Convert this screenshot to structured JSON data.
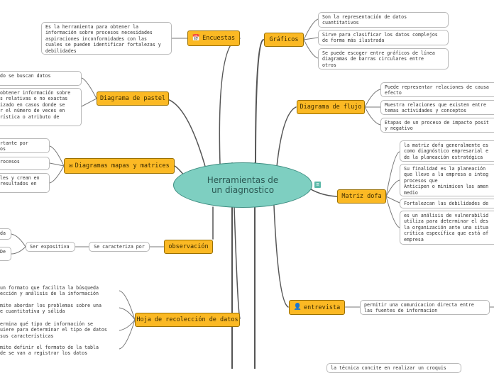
{
  "center": {
    "label": "Herramientas de\nun diagnostico"
  },
  "topics": {
    "graficos": "Gráficos",
    "encuestas": "Encuestas",
    "diagrama_pastel": "Diagrama de pastel",
    "diagrama_flujo": "Diagrama de flujo",
    "diagramas_mapas": "Diagramas mapas y matrices",
    "matriz_dofa": "Matriz dofa",
    "observacion": "observación",
    "se_caracteriza": "Se caracteriza por",
    "ser_expositiva": "Ser expositiva",
    "entrevista": "entrevista",
    "hoja_recoleccion": "Hoja de recolección de datos"
  },
  "notes": {
    "encuestas_1": "Es la herramienta para obtener la\ninformación sobre procesos necesidades\naspiraciones inconformidades con las\ncuales se pueden identificar fortalezas y\ndebilidades",
    "graficos_1": "Son la representación de datos\ncuantitativos",
    "graficos_2": "Sirve para clasificar los datos complejos\nde forma más ilustrada",
    "graficos_3": "Se puede escoger entre gráficos de línea\ndiagramas de barras circulares entre\notros",
    "pastel_1": "do se buscan datos",
    "pastel_2": "obtener información sobre\ns relativas o no exactas\nizado en casos donde se\nr el número de veces en\nrística o atributo de",
    "mapas_1": "rtante por\nos",
    "mapas_2": "rocesos",
    "mapas_3": "les y crean en\n resultados en",
    "flujo_1": "Puede representar relaciones de causa\nefecto",
    "flujo_2": "Muestra relaciones que existen entre\ntemas actividades y conceptos",
    "flujo_3": "Etapas de un proceso de impacto posit\ny negativo",
    "dofa_1": "la matriz dofa generalmente es\ncomo diagnóstico empresarial e\nde la planeación estratégica",
    "dofa_2": "Su finalidad es la planeación\nque lleve a la empresa a integ\nprocesos que\nAnticipen o minimicen las amen\nmedio",
    "dofa_3": "Fortalezcan las debilidades de",
    "dofa_4": "es un análisis de vulnerabilid\nutiliza para determinar el des\nla organización ante una situa\ncrítica específica que está af\nempresa",
    "obs_1": "da",
    "obs_2": " De\n",
    "entrevista_1": "permitir una  comunicacion directa entre\nlas fuentes de informacion",
    "hoja_1": "un formato que facilita la búsqueda\nección y análisis de la información",
    "hoja_2": "mite abordar los problemas sobre una\ne cuantitativa y sólida",
    "hoja_3": "ermina qué tipo de información se\nuiere para determinar el tipo de datos\nsus características",
    "hoja_4": "mite definir el formato de la tabla\nde se van a registrar los datos",
    "bottom_1": "la técnica concite en realizar un croquis"
  }
}
